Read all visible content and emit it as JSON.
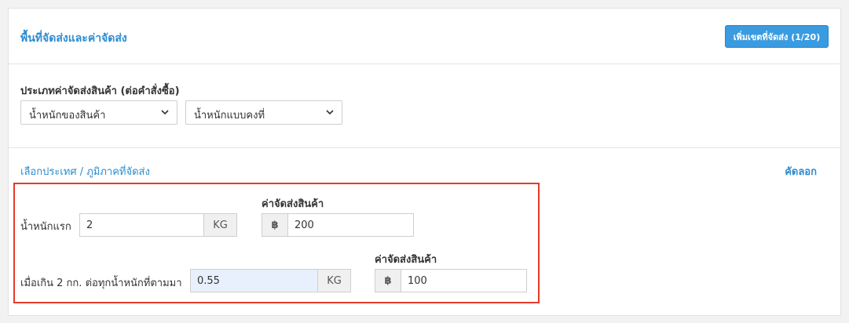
{
  "header": {
    "title": "พื้นที่จัดส่งและค่าจัดส่ง",
    "add_button": "เพิ่มเขตที่จัดส่ง (1/20)"
  },
  "shipping_type": {
    "label": "ประเภทค่าจัดส่งสินค้า (ต่อคำสั่งซื้อ)",
    "select1_value": "น้ำหนักของสินค้า",
    "select2_value": "น้ำหนักแบบคงที่"
  },
  "region": {
    "select_link": "เลือกประเทศ / ภูมิภาคที่จัดส่ง",
    "copy_link": "คัดลอก"
  },
  "rates": {
    "first_weight_label": "น้ำหนักแรก",
    "first_weight_value": "2",
    "first_weight_unit": "KG",
    "first_fee_label": "ค่าจัดส่งสินค้า",
    "first_fee_currency": "฿",
    "first_fee_value": "200",
    "extra_weight_label": "เมื่อเกิน 2 กก. ต่อทุกน้ำหนักที่ตามมา",
    "extra_weight_value": "0.55",
    "extra_weight_unit": "KG",
    "extra_fee_label": "ค่าจัดส่งสินค้า",
    "extra_fee_currency": "฿",
    "extra_fee_value": "100"
  },
  "colors": {
    "accent": "#2d8ccf",
    "button": "#3a9be0",
    "highlight_border": "#e53a2a"
  }
}
